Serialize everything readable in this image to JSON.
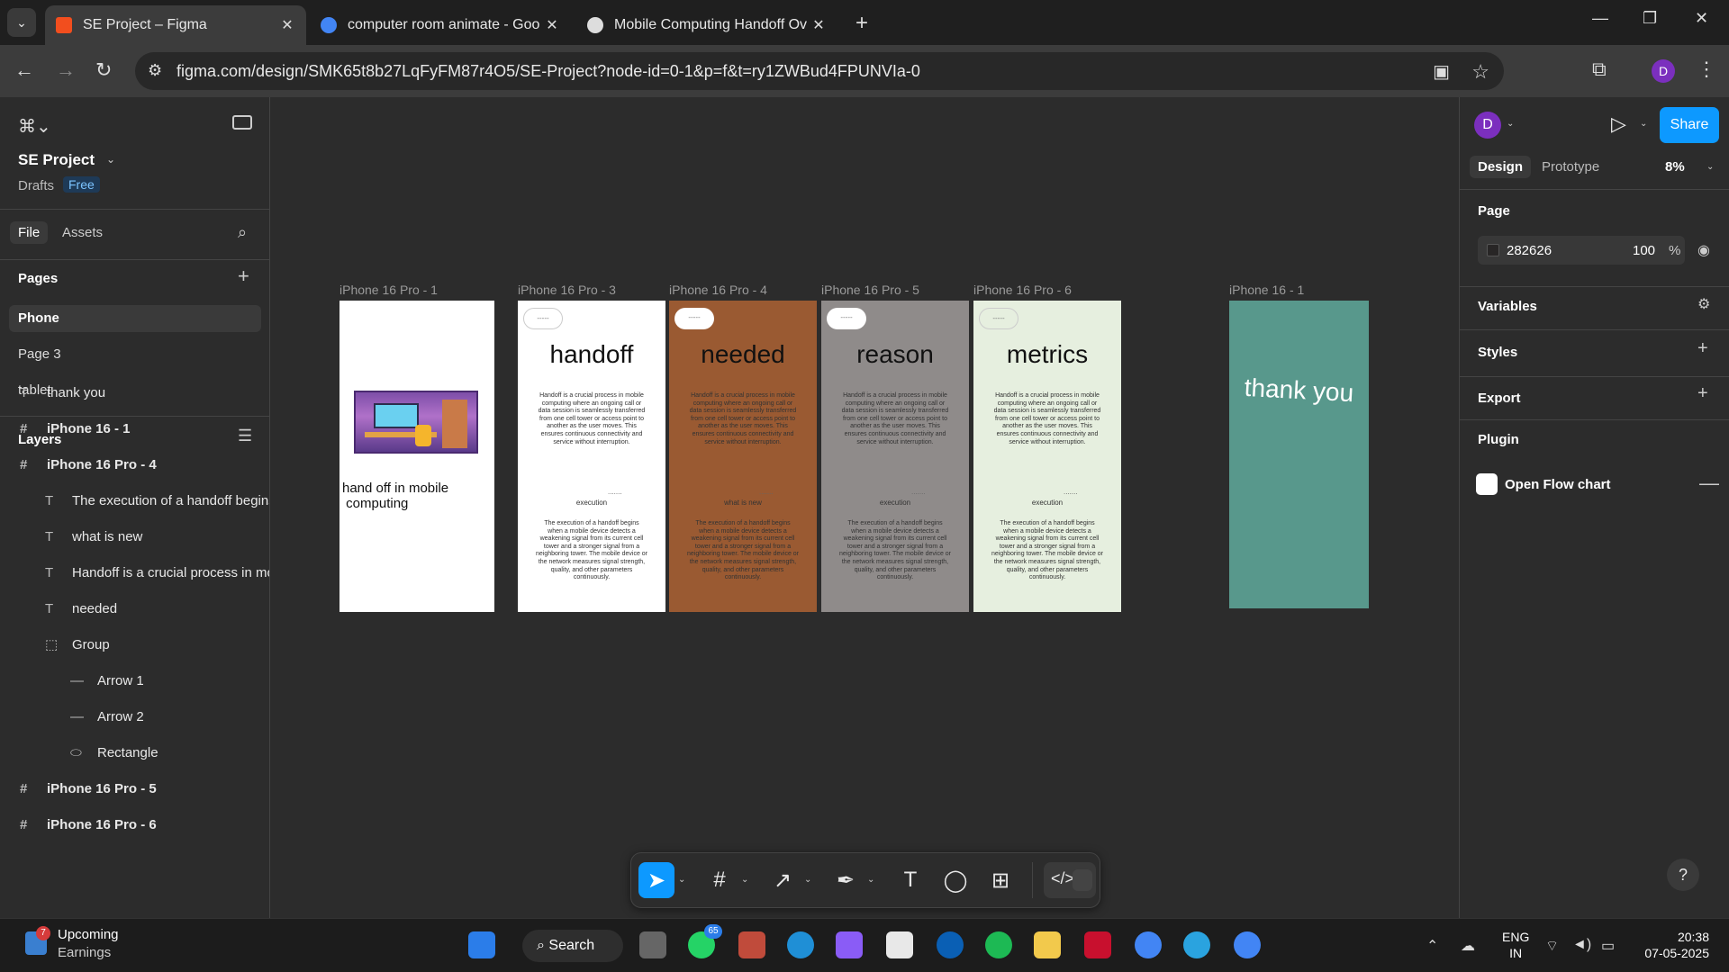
{
  "browser": {
    "tabs": [
      {
        "title": "SE Project – Figma",
        "icon_color": "#f24e1e",
        "active": true
      },
      {
        "title": "computer room animate - Goo",
        "icon_color": "#4285f4",
        "active": false
      },
      {
        "title": "Mobile Computing Handoff Ov",
        "icon_color": "#dddddd",
        "active": false
      }
    ],
    "url": "figma.com/design/SMK65t8b27LqFyFM87r4O5/SE-Project?node-id=0-1&p=f&t=ry1ZWBud4FPUNVIa-0",
    "profile_initial": "D"
  },
  "left_panel": {
    "project_name": "SE Project",
    "drafts_label": "Drafts",
    "plan_badge": "Free",
    "tabs": [
      "File",
      "Assets"
    ],
    "pages_title": "Pages",
    "pages": [
      "Phone",
      "Page 3",
      "tablet"
    ],
    "layers_title": "Layers",
    "layers": [
      {
        "name": "thank you",
        "type": "text",
        "indent": 0
      },
      {
        "name": "iPhone 16 - 1",
        "type": "frame",
        "indent": 0
      },
      {
        "name": "iPhone 16 Pro - 4",
        "type": "frame",
        "indent": 0
      },
      {
        "name": "The execution of a handoff begins",
        "type": "text",
        "indent": 1
      },
      {
        "name": "what is new",
        "type": "text",
        "indent": 1
      },
      {
        "name": "Handoff is a crucial process in mo",
        "type": "text",
        "indent": 1
      },
      {
        "name": "needed",
        "type": "text",
        "indent": 1
      },
      {
        "name": "Group",
        "type": "group",
        "indent": 1
      },
      {
        "name": "Arrow 1",
        "type": "line",
        "indent": 2
      },
      {
        "name": "Arrow 2",
        "type": "line",
        "indent": 2
      },
      {
        "name": "Rectangle",
        "type": "ellipse",
        "indent": 2
      },
      {
        "name": "iPhone 16 Pro - 5",
        "type": "frame",
        "indent": 0
      },
      {
        "name": "iPhone 16 Pro - 6",
        "type": "frame",
        "indent": 0
      }
    ]
  },
  "canvas": {
    "frames": [
      {
        "label": "iPhone 16 Pro - 1",
        "bg": "#ffffff",
        "kind": "intro",
        "text": "hand off in mobile\n computing"
      },
      {
        "label": "iPhone 16 Pro - 3",
        "bg": "#ffffff",
        "kind": "content",
        "title": "handoff",
        "pill": "outline"
      },
      {
        "label": "iPhone 16 Pro - 4",
        "bg": "#9a5a32",
        "kind": "content",
        "title": "needed",
        "pill": "solid"
      },
      {
        "label": "iPhone 16 Pro - 5",
        "bg": "#8f8b8a",
        "kind": "content",
        "title": "reason",
        "pill": "solid"
      },
      {
        "label": "iPhone 16 Pro - 6",
        "bg": "#e6efdf",
        "kind": "content",
        "title": "metrics",
        "pill": "outline"
      },
      {
        "label": "iPhone 16 - 1",
        "bg": "#58988c",
        "kind": "thanks",
        "title": "thank you"
      }
    ],
    "pill_text": "-----",
    "body_1": "Handoff is a crucial process in mobile computing where an ongoing call or data session is seamlessly transferred from one cell tower or access point to another as the user moves. This ensures continuous connectivity and service without interruption.",
    "small_dash": ".......",
    "mid_labels": [
      "execution",
      "execution",
      "what is new",
      "execution",
      "execution"
    ],
    "body_2": "The execution of a handoff begins when a mobile device detects a weakening signal from its current cell tower and a stronger signal from a neighboring tower. The mobile device or the network measures signal strength, quality, and other parameters continuously."
  },
  "right_panel": {
    "avatar": "D",
    "share": "Share",
    "tabs": [
      "Design",
      "Prototype"
    ],
    "zoom": "8%",
    "page_title": "Page",
    "page_color_hex": "282626",
    "page_opacity": "100",
    "percent": "%",
    "sections": [
      "Variables",
      "Styles",
      "Export",
      "Plugin"
    ],
    "plugin_name": "Open Flow chart",
    "help": "?"
  },
  "taskbar": {
    "weather_line1": "Upcoming",
    "weather_line2": "Earnings",
    "weather_badge": "7",
    "search": "Search",
    "whatsapp_badge": "65",
    "lang_line1": "ENG",
    "lang_line2": "IN",
    "time": "20:38",
    "date": "07-05-2025"
  }
}
